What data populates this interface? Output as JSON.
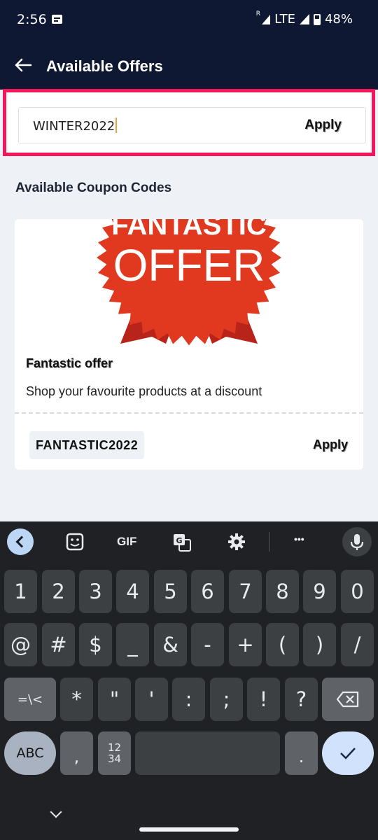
{
  "status_bar": {
    "time": "2:56",
    "network": "LTE",
    "roaming": "R",
    "battery": "48%"
  },
  "header": {
    "title": "Available Offers"
  },
  "coupon_input": {
    "value": "WINTER2022",
    "apply_label": "Apply"
  },
  "section": {
    "title": "Available Coupon Codes"
  },
  "offer": {
    "banner_line1": "FANTASTIC",
    "banner_line2": "OFFER",
    "title": "Fantastic offer",
    "description": "Shop your favourite products at a discount",
    "code": "FANTASTIC2022",
    "apply_label": "Apply",
    "colors": {
      "banner_red": "#e0391f",
      "ribbon_red": "#b8231a"
    }
  },
  "keyboard": {
    "toolbar": {
      "gif_label": "GIF",
      "more_label": "•••"
    },
    "row1": [
      "1",
      "2",
      "3",
      "4",
      "5",
      "6",
      "7",
      "8",
      "9",
      "0"
    ],
    "row2": [
      "@",
      "#",
      "$",
      "_",
      "&",
      "-",
      "+",
      "(",
      ")",
      "/"
    ],
    "row3": [
      "=\\<",
      "*",
      "\"",
      "'",
      ":",
      ";",
      "!",
      "?"
    ],
    "abc_label": "ABC",
    "comma": ",",
    "numpad_label": "12\n34",
    "period": "."
  },
  "colors": {
    "header_bg": "#0f1833",
    "highlight": "#f2175a",
    "page_bg": "#eef1f5"
  }
}
